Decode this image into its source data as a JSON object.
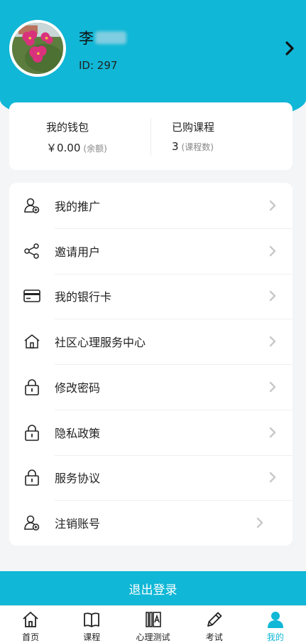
{
  "profile": {
    "name": "李",
    "id_text": "ID: 297"
  },
  "stats": {
    "wallet": {
      "title": "我的钱包",
      "value": "￥0.00",
      "unit": "(余额)"
    },
    "courses": {
      "title": "已购课程",
      "value": "3",
      "unit": "(课程数)"
    }
  },
  "menu": [
    {
      "label": "我的推广",
      "icon": "user-plus-icon"
    },
    {
      "label": "邀请用户",
      "icon": "share-icon"
    },
    {
      "label": "我的银行卡",
      "icon": "bank-card-icon"
    },
    {
      "label": "社区心理服务中心",
      "icon": "house-icon"
    },
    {
      "label": "修改密码",
      "icon": "lock-icon"
    },
    {
      "label": "隐私政策",
      "icon": "lock-icon"
    },
    {
      "label": "服务协议",
      "icon": "lock-icon"
    },
    {
      "label": "注销账号",
      "icon": "user-plus-icon"
    }
  ],
  "logout": {
    "label": "退出登录"
  },
  "tabbar": [
    {
      "label": "首页",
      "icon": "home-icon"
    },
    {
      "label": "课程",
      "icon": "book-icon"
    },
    {
      "label": "心理测试",
      "icon": "test-book-icon"
    },
    {
      "label": "考试",
      "icon": "pencil-icon"
    },
    {
      "label": "我的",
      "icon": "person-icon",
      "active": true
    }
  ],
  "colors": {
    "accent": "#10b7d6",
    "background": "#f4f5f7"
  }
}
